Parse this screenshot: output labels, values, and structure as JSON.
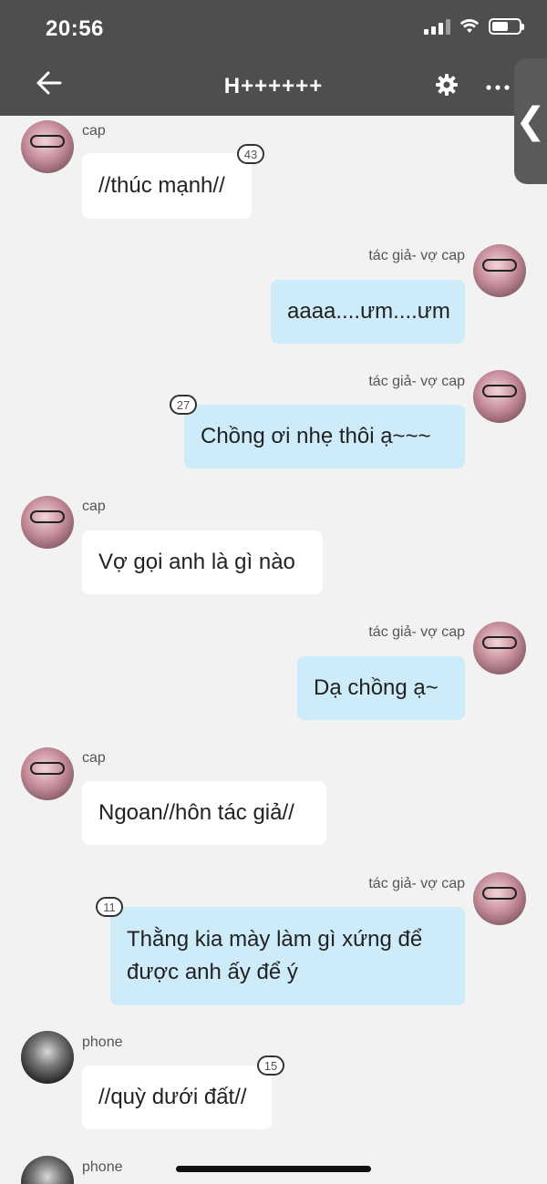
{
  "status": {
    "time": "20:56"
  },
  "header": {
    "title": "H++++++",
    "back_icon": "arrow-left-icon",
    "gear_icon": "gear-icon",
    "more_icon": "more-horizontal-icon",
    "side_tab_icon": "chevron-left-icon",
    "side_tab_glyph": "❮"
  },
  "colors": {
    "header_bg": "#4e4e4e",
    "chat_bg": "#f2f2f2",
    "bubble_left": "#ffffff",
    "bubble_right": "#cdebf8"
  },
  "messages": [
    {
      "side": "left",
      "sender": "cap",
      "text": "//thúc mạnh//",
      "badge": "43"
    },
    {
      "side": "right",
      "sender": "tác giả- vợ cap",
      "text": "aaaa....ưm....ưm",
      "badge": ""
    },
    {
      "side": "right",
      "sender": "tác giả- vợ cap",
      "text": "Chồng ơi nhẹ thôi ạ~~~",
      "badge": "27"
    },
    {
      "side": "left",
      "sender": "cap",
      "text": "Vợ gọi anh là gì nào",
      "badge": ""
    },
    {
      "side": "right",
      "sender": "tác giả- vợ cap",
      "text": "Dạ chồng ạ~",
      "badge": ""
    },
    {
      "side": "left",
      "sender": "cap",
      "text": "Ngoan//hôn tác giả//",
      "badge": ""
    },
    {
      "side": "right",
      "sender": "tác giả- vợ cap",
      "text": "Thằng kia mày làm gì xứng để được anh ấy để ý",
      "badge": "11"
    },
    {
      "side": "left",
      "sender": "phone",
      "text": "//quỳ dưới đất//",
      "badge": "15"
    },
    {
      "side": "left",
      "sender": "phone",
      "text": "",
      "badge": ""
    }
  ]
}
